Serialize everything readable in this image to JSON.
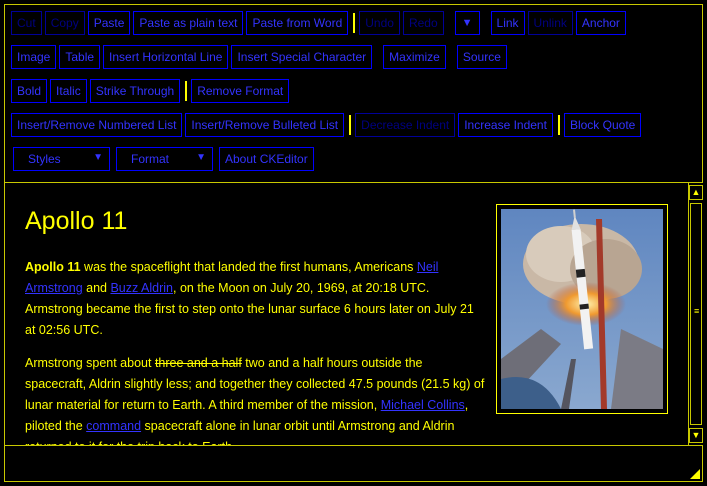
{
  "toolbar": {
    "row1": {
      "cut": "Cut",
      "copy": "Copy",
      "paste": "Paste",
      "paste_plain": "Paste as plain text",
      "paste_word": "Paste from Word",
      "undo": "Undo",
      "redo": "Redo",
      "more": "▼",
      "link": "Link",
      "unlink": "Unlink",
      "anchor": "Anchor"
    },
    "row2": {
      "image": "Image",
      "table": "Table",
      "hline": "Insert Horizontal Line",
      "special_char": "Insert Special Character",
      "maximize": "Maximize",
      "source": "Source"
    },
    "row3": {
      "bold": "Bold",
      "italic": "Italic",
      "strike": "Strike Through",
      "remove_format": "Remove Format"
    },
    "row4": {
      "numbered": "Insert/Remove Numbered List",
      "bulleted": "Insert/Remove Bulleted List",
      "dec_indent": "Decrease Indent",
      "inc_indent": "Increase Indent",
      "blockquote": "Block Quote"
    },
    "row5": {
      "styles": "Styles",
      "format": "Format",
      "about": "About CKEditor",
      "arrow": "▼"
    }
  },
  "document": {
    "title": "Apollo 11",
    "p1": {
      "bold": "Apollo 11",
      "t1": " was the spaceflight that landed the first humans, Americans ",
      "link1": "Neil Armstrong",
      "t2": " and ",
      "link2": "Buzz Aldrin",
      "t3": ", on the Moon on July 20, 1969, at 20:18 UTC. Armstrong became the first to step onto the lunar surface 6 hours later on July 21 at 02:56 UTC."
    },
    "p2": {
      "t1": "Armstrong spent about ",
      "strike": "three and a half",
      "t2": " two and a half hours outside the spacecraft, Aldrin slightly less; and together they collected 47.5 pounds (21.5 kg) of lunar material for return to Earth. A third member of the mission, ",
      "link1": "Michael Collins",
      "t3": ", piloted the ",
      "link2": "command",
      "t4": " spacecraft alone in lunar orbit until Armstrong and Aldrin returned to it for the trip back to Earth."
    }
  },
  "scrollbar": {
    "up": "▲",
    "down": "▼",
    "grip": "≡"
  },
  "colors": {
    "text": "#ffff00",
    "link": "#3333ff",
    "button_border": "#0000ff",
    "background": "#000000"
  }
}
